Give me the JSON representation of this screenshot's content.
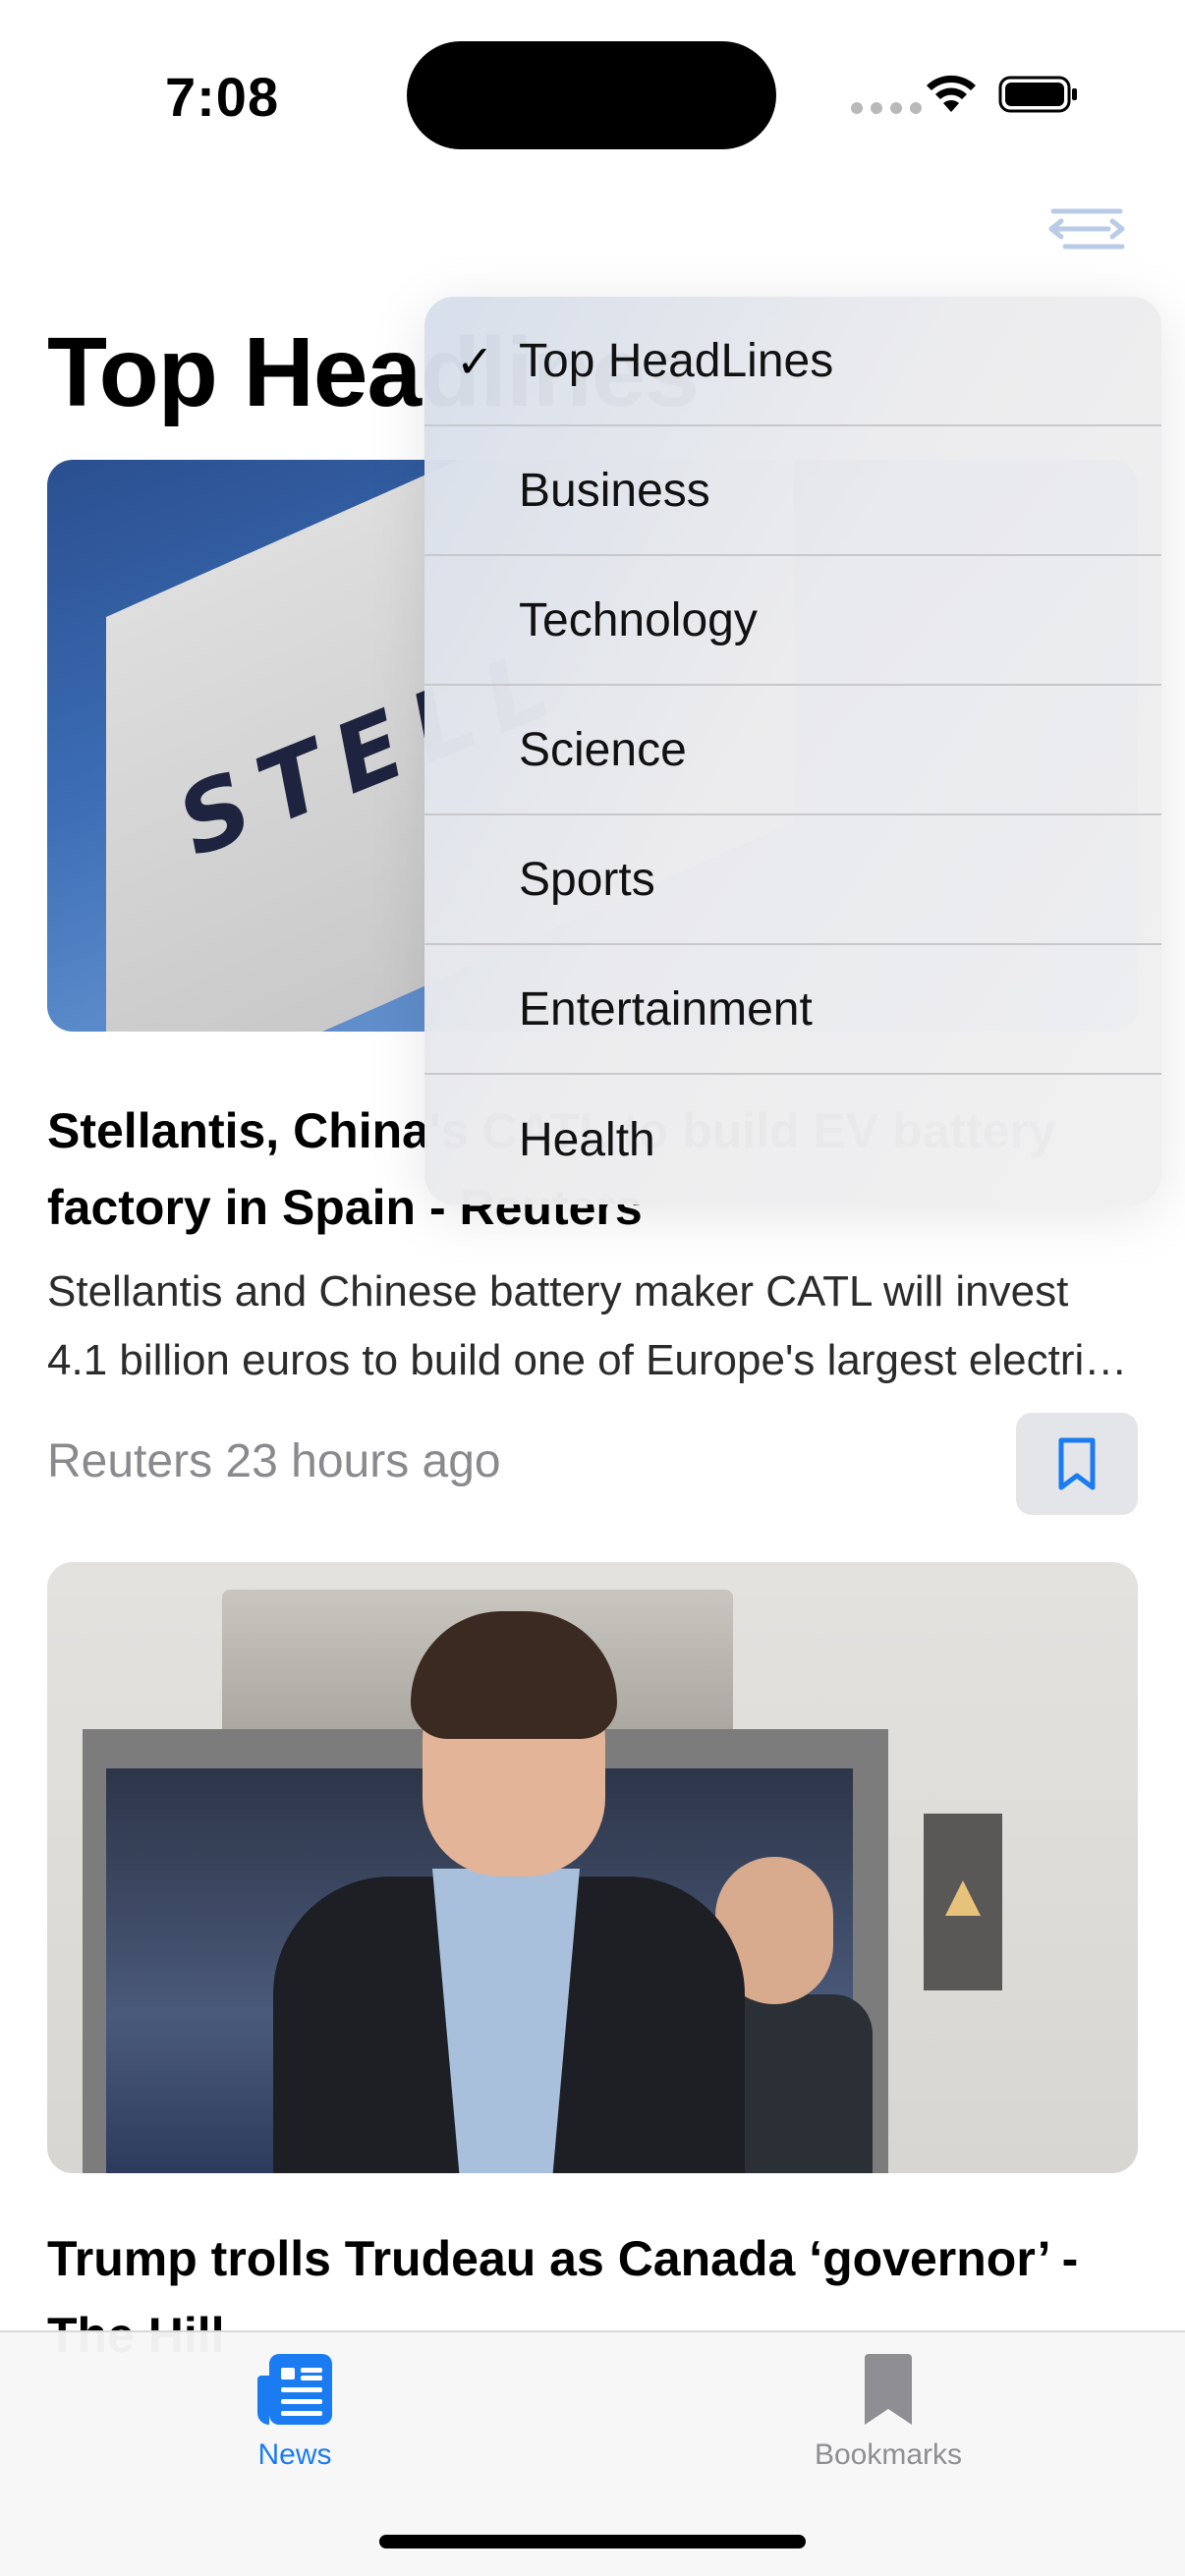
{
  "status_bar": {
    "time": "7:08"
  },
  "page": {
    "title": "Top Headlines"
  },
  "articles": [
    {
      "headline": "Stellantis, China's CATL to build EV battery factory in Spain - Reuters",
      "summary": "Stellantis and Chinese battery maker CATL will invest 4.1 billion euros to build one of Europe's largest electric vehicle battery plants.",
      "meta": "Reuters 23 hours ago",
      "image_text": "STELL"
    },
    {
      "headline": "Trump trolls Trudeau as Canada ‘governor’ - The Hill"
    }
  ],
  "menu": {
    "items": [
      {
        "label": "Top HeadLines",
        "checked": "✓"
      },
      {
        "label": "Business"
      },
      {
        "label": "Technology"
      },
      {
        "label": "Science"
      },
      {
        "label": "Sports"
      },
      {
        "label": "Entertainment"
      },
      {
        "label": "Health"
      }
    ]
  },
  "tab_bar": {
    "tabs": [
      {
        "label": "News",
        "icon": "newspaper-icon",
        "selected": true
      },
      {
        "label": "Bookmarks",
        "icon": "bookmark-icon",
        "selected": false
      }
    ]
  },
  "colors": {
    "accent": "#1a7cf0",
    "inactive": "#8e8e93",
    "meta_text": "#8a8a8e"
  }
}
